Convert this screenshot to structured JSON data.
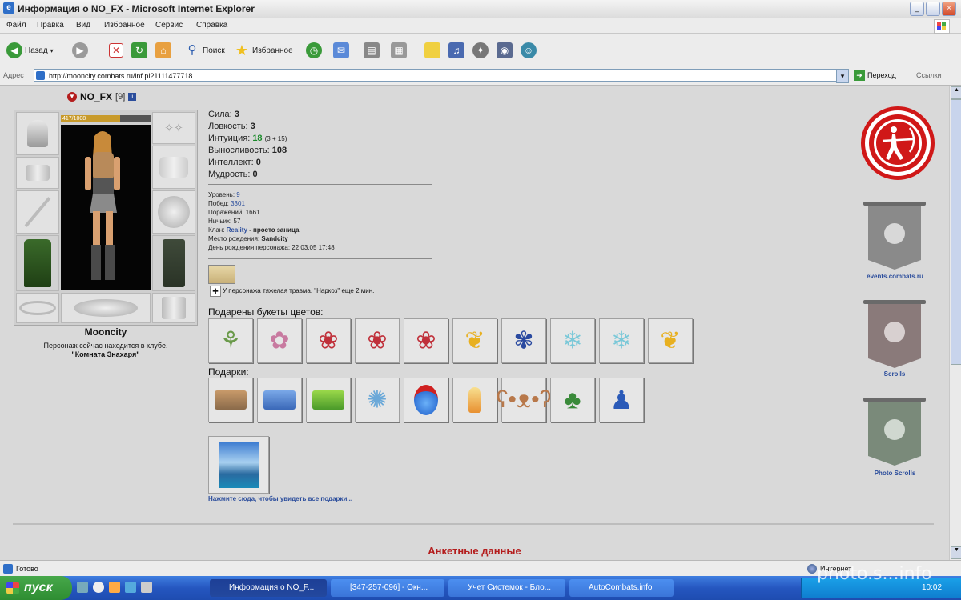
{
  "window": {
    "title": "Информация о NO_FX - Microsoft Internet Explorer"
  },
  "menu": [
    "Файл",
    "Правка",
    "Вид",
    "Избранное",
    "Сервис",
    "Справка"
  ],
  "toolbar": {
    "back_label": "Назад",
    "search_label": "Поиск",
    "favorites_label": "Избранное"
  },
  "address": {
    "label": "Адрес",
    "url": "http://mooncity.combats.ru/inf.pl?1111477718",
    "go_label": "Переход",
    "links_label": "Ссылки"
  },
  "character": {
    "name": "NO_FX",
    "level_badge": "[9]",
    "hp_text": "417/1008",
    "hp_fraction": 0.66,
    "city": "Mooncity",
    "location_text": "Персонаж сейчас находится в клубе.",
    "room": "\"Комната Знахаря\""
  },
  "stats": [
    {
      "label": "Сила:",
      "value": "3",
      "extra": ""
    },
    {
      "label": "Ловкость:",
      "value": "3",
      "extra": ""
    },
    {
      "label": "Интуиция:",
      "value": "18",
      "extra": "(3 + 15)"
    },
    {
      "label": "Выносливость:",
      "value": "108",
      "extra": ""
    },
    {
      "label": "Интеллект:",
      "value": "0",
      "extra": ""
    },
    {
      "label": "Мудрость:",
      "value": "0",
      "extra": ""
    }
  ],
  "info": [
    {
      "label": "Уровень:",
      "value": "9"
    },
    {
      "label": "Побед:",
      "value": "3301"
    },
    {
      "label": "Поражений:",
      "value": "1661"
    },
    {
      "label": "Ничьих:",
      "value": "57"
    },
    {
      "label": "Клан:",
      "value": "Reality",
      "extra": "- просто заница"
    },
    {
      "label": "Место рождения:",
      "value": "Sandcity"
    },
    {
      "label": "День рождения персонажа:",
      "value": "22.03.05 17:48"
    }
  ],
  "effect_text": "У персонажа тяжелая травма. \"Наркоз\" еще 2 мин.",
  "sections": {
    "flowers_title": "Подарены букеты цветов:",
    "gifts_title": "Подарки:",
    "see_all_link": "Нажмите сюда, чтобы увидеть все подарки...",
    "profile_title": "Анкетные данные"
  },
  "banners": {
    "events_label": "events.combats.ru",
    "scrolls_label": "Scrolls",
    "photo_label": "Photo Scrolls"
  },
  "status": {
    "left": "Готово",
    "zone": "Интернет"
  },
  "taskbar": {
    "start": "пуск",
    "tasks": [
      "Информация о NO_F...",
      "[347-257-096] - Окн...",
      "Учет Системок - Бло...",
      "AutoCombats.info"
    ],
    "clock": "10:02"
  },
  "watermark": "photo.s...info",
  "colors": {
    "accent_red": "#b41d1d",
    "link_blue": "#2b4d9c",
    "taskbar_blue": "#2556c0"
  }
}
